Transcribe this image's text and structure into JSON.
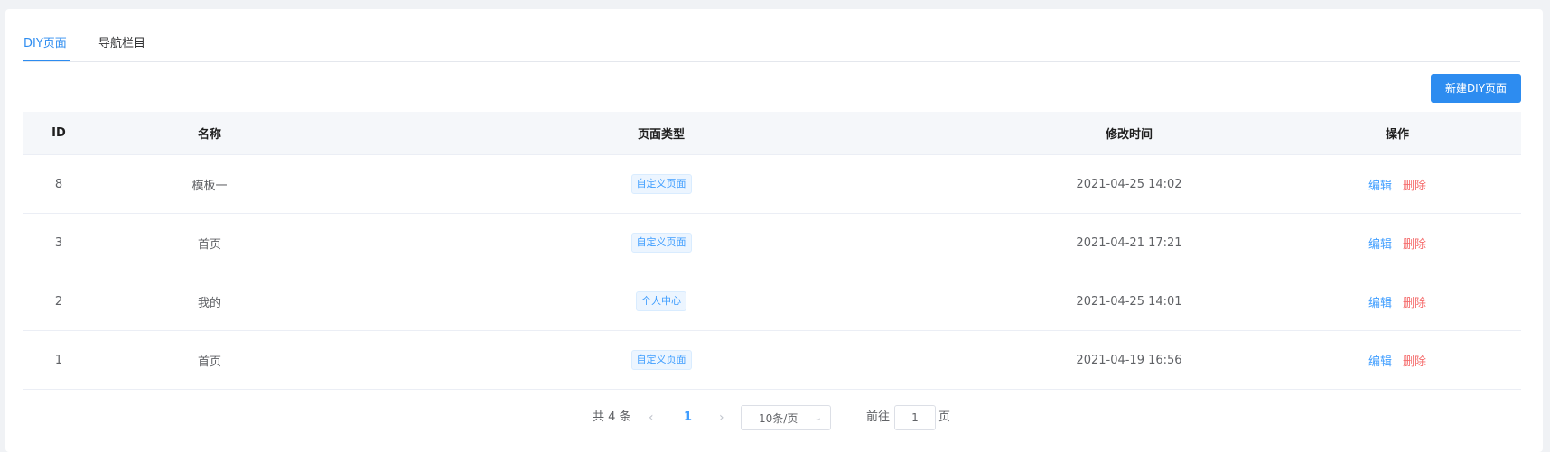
{
  "tabs": [
    {
      "label": "DIY页面",
      "active": true
    },
    {
      "label": "导航栏目",
      "active": false
    }
  ],
  "toolbar": {
    "new_label": "新建DIY页面"
  },
  "table": {
    "headers": {
      "id": "ID",
      "name": "名称",
      "type": "页面类型",
      "time": "修改时间",
      "ops": "操作"
    },
    "rows": [
      {
        "id": "8",
        "name": "模板一",
        "type": "自定义页面",
        "time": "2021-04-25 14:02"
      },
      {
        "id": "3",
        "name": "首页",
        "type": "自定义页面",
        "time": "2021-04-21 17:21"
      },
      {
        "id": "2",
        "name": "我的",
        "type": "个人中心",
        "time": "2021-04-25 14:01"
      },
      {
        "id": "1",
        "name": "首页",
        "type": "自定义页面",
        "time": "2021-04-19 16:56"
      }
    ],
    "ops": {
      "edit": "编辑",
      "delete": "删除"
    }
  },
  "pagination": {
    "total": "共 4 条",
    "current_page": "1",
    "page_size": "10条/页",
    "goto_prefix": "前往",
    "goto_value": "1",
    "goto_suffix": "页"
  },
  "colors": {
    "accent": "#2d8cf0",
    "danger": "#f56c6c"
  }
}
